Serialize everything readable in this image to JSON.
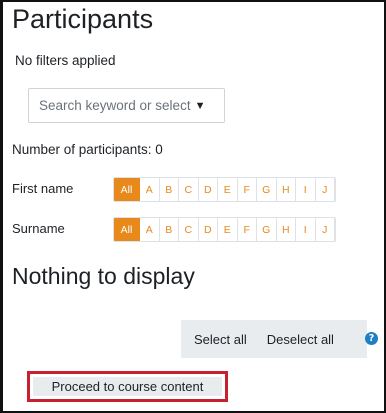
{
  "page": {
    "title": "Participants",
    "filters_text": "No filters applied",
    "participant_count_text": "Number of participants: 0",
    "empty_message": "Nothing to display"
  },
  "search": {
    "placeholder": "Search keyword or select",
    "caret_icon": "caret-down-icon"
  },
  "first_name_filter": {
    "label": "First name",
    "letters": [
      "All",
      "A",
      "B",
      "C",
      "D",
      "E",
      "F",
      "G",
      "H",
      "I",
      "J"
    ],
    "selected": "All"
  },
  "surname_filter": {
    "label": "Surname",
    "letters": [
      "All",
      "A",
      "B",
      "C",
      "D",
      "E",
      "F",
      "G",
      "H",
      "I",
      "J"
    ],
    "selected": "All"
  },
  "bulk_actions": {
    "select_all": "Select all",
    "deselect_all": "Deselect all",
    "help_icon": "help-icon",
    "help_glyph": "?"
  },
  "proceed_button": {
    "label": "Proceed to course content",
    "highlight_color": "#c8202f"
  },
  "colors": {
    "accent": "#e8891c",
    "help": "#1f7fc4",
    "button_bg": "#e9ecef"
  }
}
